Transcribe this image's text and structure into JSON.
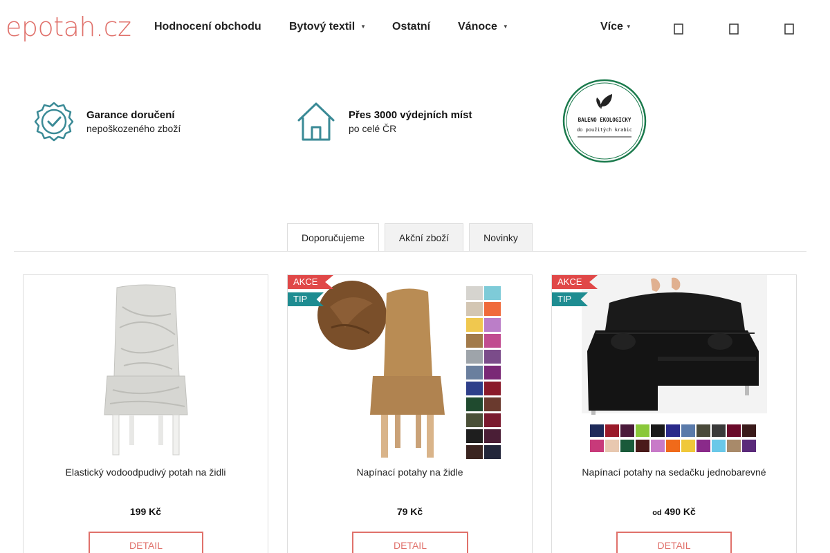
{
  "header": {
    "logo_text": "epotah.cz",
    "nav": [
      {
        "label": "Hodnocení obchodu",
        "has_dropdown": false
      },
      {
        "label": "Bytový textil",
        "has_dropdown": true
      },
      {
        "label": "Ostatní",
        "has_dropdown": false
      },
      {
        "label": "Vánoce",
        "has_dropdown": true
      },
      {
        "label": "Více",
        "has_dropdown": true
      }
    ],
    "caret_glyph": "▼",
    "icons": [
      "search-icon",
      "user-icon",
      "cart-icon"
    ]
  },
  "benefits": [
    {
      "icon": "badge-check-icon",
      "title": "Garance doručení",
      "subtitle": "nepoškozeného zboží"
    },
    {
      "icon": "house-icon",
      "title": "Přes 3000 výdejních míst",
      "subtitle": "po celé ČR"
    }
  ],
  "eco_badge": {
    "line1": "BALENO EKOLOGICKY",
    "line2": "do použitých krabic",
    "color": "#1a7a4c"
  },
  "tabs": [
    {
      "label": "Doporučujeme",
      "active": true
    },
    {
      "label": "Akční zboží",
      "active": false
    },
    {
      "label": "Novinky",
      "active": false
    }
  ],
  "products": [
    {
      "name": "Elastický vodoodpudivý potah na židli",
      "price_prefix": "",
      "price": "199 Kč",
      "button": "DETAIL",
      "flags": []
    },
    {
      "name": "Napínací potahy na židle",
      "price_prefix": "",
      "price": "79 Kč",
      "button": "DETAIL",
      "flags": [
        "AKCE",
        "TIP"
      ]
    },
    {
      "name": "Napínací potahy na sedačku jednobarevné",
      "price_prefix": "od",
      "price": "490 Kč",
      "button": "DETAIL",
      "flags": [
        "AKCE",
        "TIP"
      ]
    }
  ],
  "colors": {
    "brand": "#e0716b",
    "icon_teal": "#3a8a96",
    "flag_akce": "#e04848",
    "flag_tip": "#1e8c91"
  }
}
